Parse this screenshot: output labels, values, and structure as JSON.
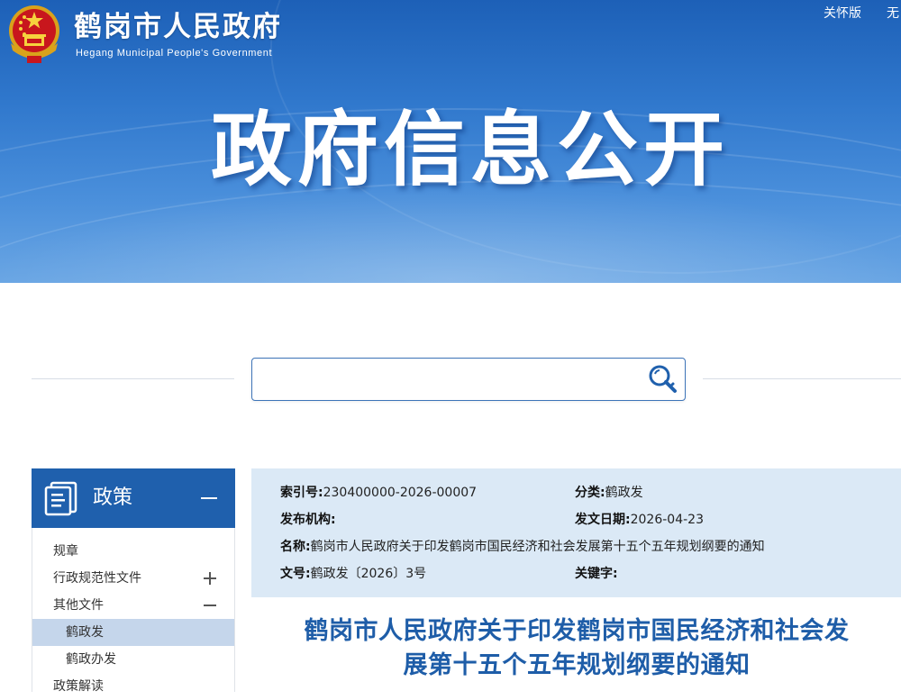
{
  "header": {
    "site_name": "鹤岗市人民政府",
    "site_name_en": "Hegang Municipal People's Government",
    "links": [
      "关怀版",
      "无"
    ],
    "hero_title": "政府信息公开"
  },
  "search": {
    "value": "",
    "placeholder": ""
  },
  "sidebar": {
    "title": "政策",
    "items": [
      {
        "label": "规章"
      },
      {
        "label": "行政规范性文件"
      },
      {
        "label": "其他文件"
      },
      {
        "label": "鹤政发"
      },
      {
        "label": "鹤政办发"
      },
      {
        "label": "政策解读"
      }
    ]
  },
  "meta": {
    "index_label": "索引号:",
    "index_value": "230400000-2026-00007",
    "category_label": "分类:",
    "category_value": "鹤政发",
    "publisher_label": "发布机构:",
    "publisher_value": "",
    "date_label": "发文日期:",
    "date_value": "2026-04-23",
    "name_label": "名称:",
    "name_value": "鹤岗市人民政府关于印发鹤岗市国民经济和社会发展第十五个五年规划纲要的通知",
    "docno_label": "文号:",
    "docno_value": "鹤政发〔2026〕3号",
    "keyword_label": "关键字:",
    "keyword_value": ""
  },
  "article": {
    "title_line1": "鹤岗市人民政府关于印发鹤岗市国民经济和社会发",
    "title_line2": "展第十五个五年规划纲要的通知"
  },
  "colors": {
    "primary": "#1f60ad",
    "title_blue": "#1e5da8",
    "meta_bg": "#dbe9f6",
    "active_item": "#c5d6eb"
  },
  "icons": [
    "national-emblem-icon",
    "search-key-icon",
    "document-icon",
    "collapse-icon",
    "plus-icon",
    "minus-icon"
  ]
}
